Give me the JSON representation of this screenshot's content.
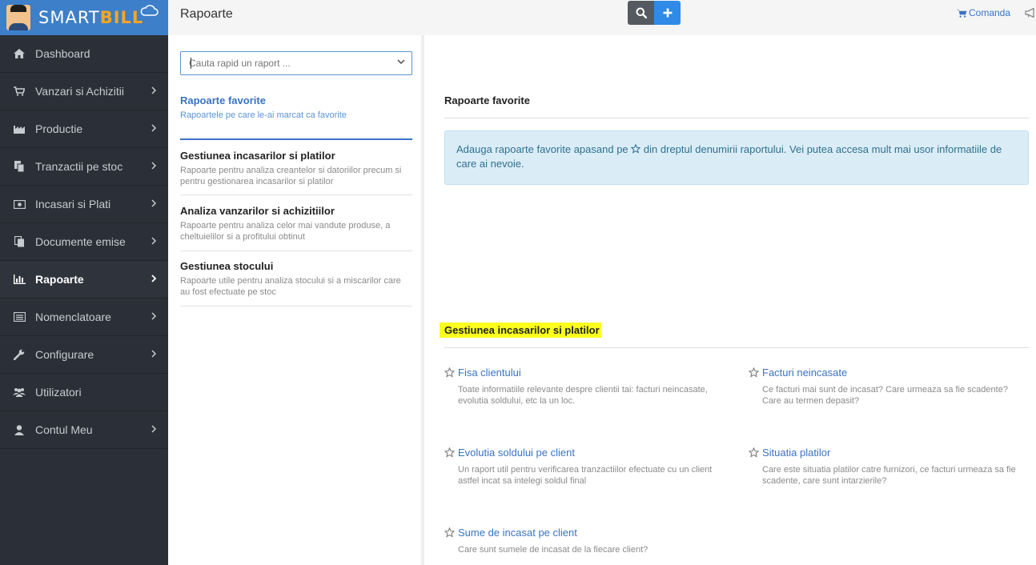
{
  "brand": {
    "name_smart": "SMART",
    "name_bill": "BILL"
  },
  "sidebar": {
    "items": [
      {
        "label": "Dashboard",
        "icon": "home-icon",
        "chevron": false
      },
      {
        "label": "Vanzari si Achizitii",
        "icon": "cart-icon",
        "chevron": true
      },
      {
        "label": "Productie",
        "icon": "factory-icon",
        "chevron": true
      },
      {
        "label": "Tranzactii pe stoc",
        "icon": "copy-icon",
        "chevron": true
      },
      {
        "label": "Incasari si Plati",
        "icon": "money-icon",
        "chevron": true
      },
      {
        "label": "Documente emise",
        "icon": "documents-icon",
        "chevron": true
      },
      {
        "label": "Rapoarte",
        "icon": "bar-chart-icon",
        "chevron": true,
        "active": true
      },
      {
        "label": "Nomenclatoare",
        "icon": "list-icon",
        "chevron": true
      },
      {
        "label": "Configurare",
        "icon": "wrench-icon",
        "chevron": true
      },
      {
        "label": "Utilizatori",
        "icon": "users-icon",
        "chevron": false
      },
      {
        "label": "Contul Meu",
        "icon": "user-icon",
        "chevron": true
      }
    ]
  },
  "header": {
    "title": "Rapoarte",
    "comanda_label": "Comanda"
  },
  "left_panel": {
    "search_placeholder": "Cauta rapid un raport ...",
    "categories": [
      {
        "title": "Rapoarte favorite",
        "desc": "Rapoartele pe care le-ai marcat ca favorite"
      },
      {
        "title": "Gestiunea incasarilor si platilor",
        "desc": "Rapoarte pentru analiza creantelor si datoriilor precum si pentru gestionarea incasarilor si platilor"
      },
      {
        "title": "Analiza vanzarilor si achizitiilor",
        "desc": "Rapoarte pentru analiza celor mai vandute produse, a cheltuielilor si a profitului obtinut"
      },
      {
        "title": "Gestiunea stocului",
        "desc": "Rapoarte utile pentru analiza stocului si a miscarilor care au fost efectuate pe stoc"
      }
    ]
  },
  "main": {
    "favorites_title": "Rapoarte favorite",
    "favorites_info_before": "Adauga rapoarte favorite apasand pe",
    "favorites_info_after": "din dreptul denumirii raportului. Vei putea accesa mult mai usor informatiile de care ai nevoie.",
    "section_title": "Gestiunea incasarilor si platilor",
    "reports": [
      {
        "title": "Fisa clientului",
        "desc": "Toate informatiile relevante despre clientii tai: facturi neincasate, evolutia soldului, etc la un loc."
      },
      {
        "title": "Facturi neincasate",
        "desc": "Ce facturi mai sunt de incasat? Care urmeaza sa fie scadente? Care au termen depasit?"
      },
      {
        "title": "Evolutia soldului pe client",
        "desc": "Un raport util pentru verificarea tranzactiilor efectuate cu un client astfel incat sa intelegi soldul final"
      },
      {
        "title": "Situatia platilor",
        "desc": "Care este situatia platilor catre furnizori, ce facturi urmeaza sa fie scadente, care sunt intarzierile?"
      },
      {
        "title": "Sume de incasat pe client",
        "desc": "Care sunt sumele de incasat de la fiecare client?"
      }
    ]
  },
  "colors": {
    "sidebar_bg": "#2b2f37",
    "logo_bg": "#3d7fc8",
    "accent": "#3a73c4",
    "highlight": "#fbff1d"
  }
}
